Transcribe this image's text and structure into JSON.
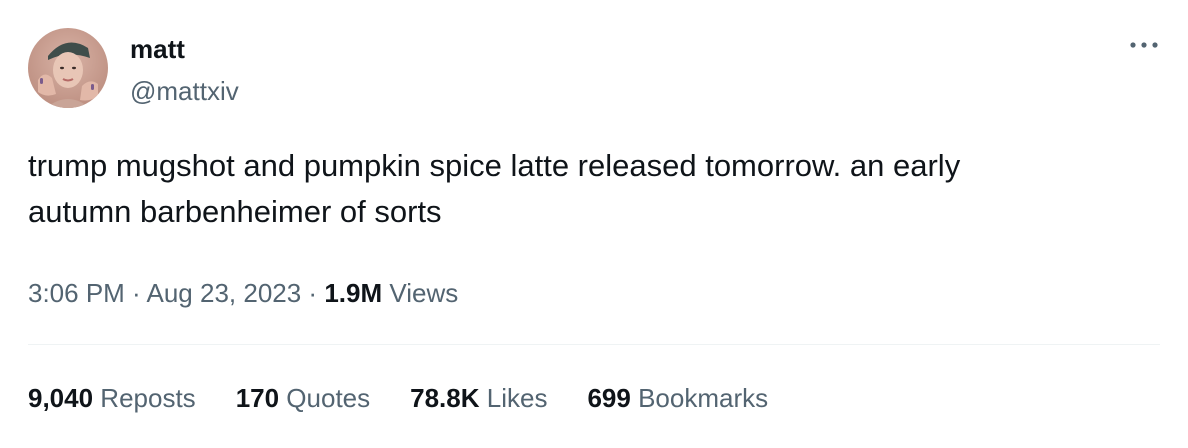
{
  "author": {
    "display_name": "matt",
    "handle": "@mattxiv",
    "avatar_icon": "user-avatar-photo"
  },
  "more_icon": "more-horizontal-icon",
  "tweet": {
    "text": "trump mugshot and pumpkin spice latte released tomorrow. an early\nautumn barbenheimer of sorts"
  },
  "meta": {
    "time": "3:06 PM",
    "separator1": " · ",
    "date": "Aug 23, 2023",
    "separator2": " · ",
    "views_count": "1.9M",
    "views_label": " Views"
  },
  "stats": {
    "reposts": {
      "count": "9,040",
      "label": " Reposts"
    },
    "quotes": {
      "count": "170",
      "label": " Quotes"
    },
    "likes": {
      "count": "78.8K",
      "label": " Likes"
    },
    "bookmarks": {
      "count": "699",
      "label": " Bookmarks"
    }
  },
  "colors": {
    "text_primary": "#0f1419",
    "text_secondary": "#536471",
    "divider": "#eff3f4"
  }
}
